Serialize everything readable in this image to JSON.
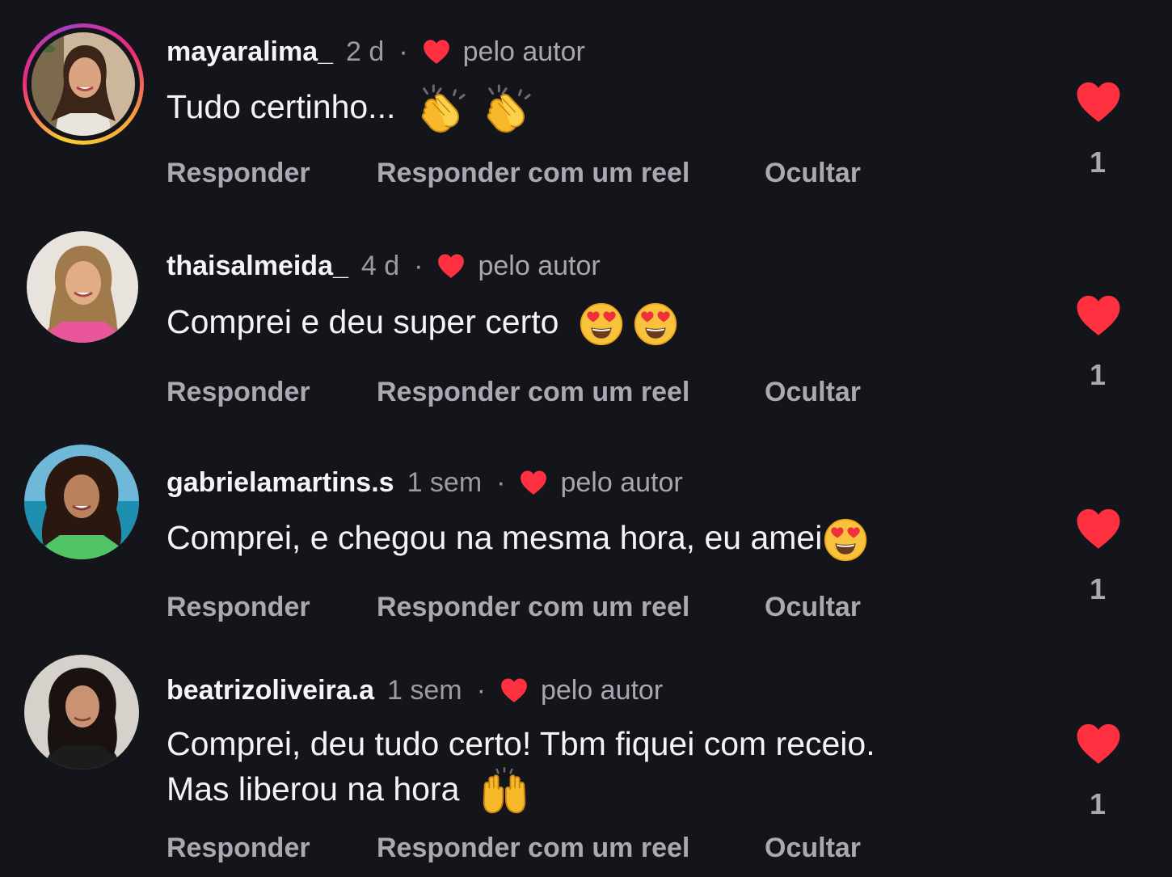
{
  "comments": [
    {
      "username": "mayaralima_",
      "time": "2 d",
      "separator": "·",
      "author_label": "pelo autor",
      "text": "Tudo certinho...",
      "emojis": [
        "clapping-hands",
        "clapping-hands"
      ],
      "actions": {
        "reply": "Responder",
        "reply_reel": "Responder com um reel",
        "hide": "Ocultar"
      },
      "likes": "1",
      "has_story_ring": true
    },
    {
      "username": "thaisalmeida_",
      "time": "4 d",
      "separator": "·",
      "author_label": "pelo autor",
      "text": "Comprei e deu super certo",
      "emojis": [
        "heart-eyes",
        "heart-eyes"
      ],
      "actions": {
        "reply": "Responder",
        "reply_reel": "Responder com um reel",
        "hide": "Ocultar"
      },
      "likes": "1",
      "has_story_ring": false
    },
    {
      "username": "gabrielamartins.s",
      "time": "1 sem",
      "separator": "·",
      "author_label": "pelo autor",
      "text": "Comprei, e chegou na mesma hora, eu amei",
      "emojis": [
        "heart-eyes"
      ],
      "actions": {
        "reply": "Responder",
        "reply_reel": "Responder com um reel",
        "hide": "Ocultar"
      },
      "likes": "1",
      "has_story_ring": false
    },
    {
      "username": "beatrizoliveira.a",
      "time": "1 sem",
      "separator": "·",
      "author_label": "pelo autor",
      "text_line1": "Comprei, deu tudo certo! Tbm fiquei com receio.",
      "text_line2": "Mas liberou na hora",
      "emojis": [
        "raising-hands"
      ],
      "actions": {
        "reply": "Responder",
        "reply_reel": "Responder com um reel",
        "hide": "Ocultar"
      },
      "likes": "1",
      "has_story_ring": false
    }
  ],
  "colors": {
    "background": "#14151b",
    "like_red": "#ff3040",
    "muted_text": "#a9aab1"
  }
}
